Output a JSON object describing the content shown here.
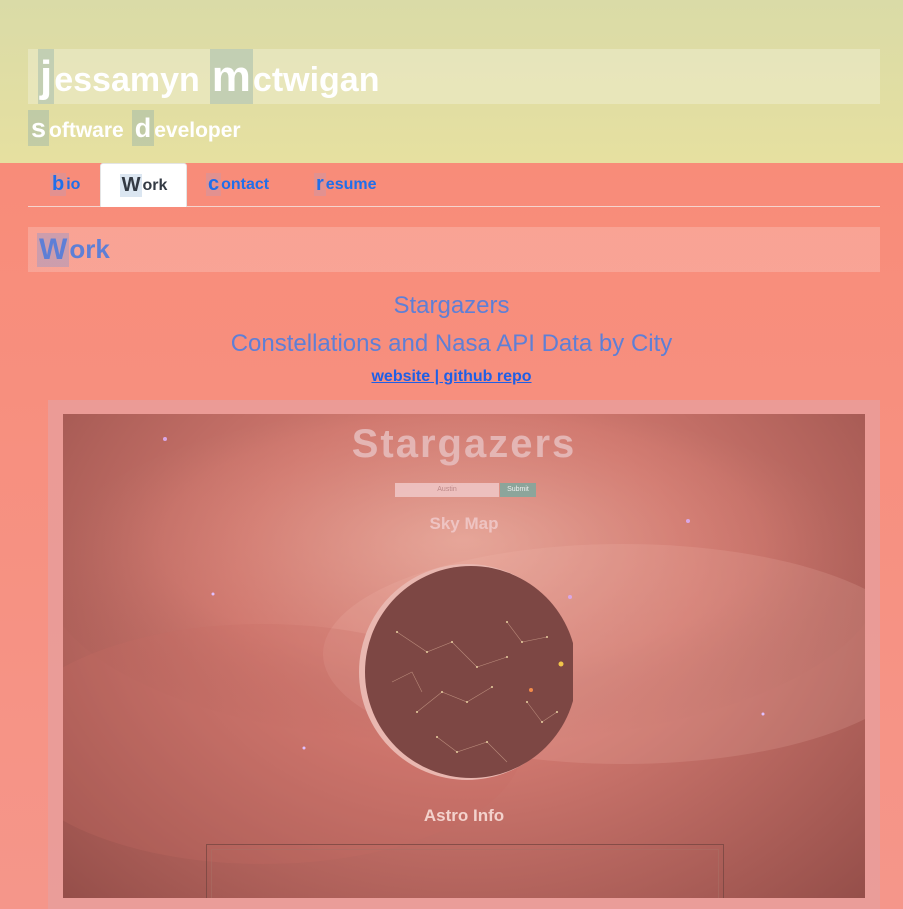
{
  "header": {
    "name": [
      {
        "cap": "j",
        "rest": "essamyn"
      },
      {
        "cap": "m",
        "rest": "ctwigan"
      }
    ],
    "subtitle": [
      {
        "cap": "s",
        "rest": "oftware"
      },
      {
        "cap": "d",
        "rest": "eveloper"
      }
    ]
  },
  "nav": {
    "tabs": [
      {
        "cap": "b",
        "rest": "io",
        "active": false
      },
      {
        "cap": "W",
        "rest": "ork",
        "active": true
      },
      {
        "cap": "c",
        "rest": "ontact",
        "active": false
      },
      {
        "cap": "r",
        "rest": "esume",
        "active": false
      }
    ]
  },
  "section": {
    "cap": "W",
    "rest": "ork"
  },
  "project": {
    "name": "Stargazers",
    "description": "Constellations and Nasa API Data by City",
    "links_text": "website | github repo",
    "screenshot": {
      "title": "Stargazers",
      "input_placeholder": "Austin",
      "submit_label": "Submit",
      "sky_map_heading": "Sky Map",
      "astro_heading": "Astro Info"
    }
  },
  "colors": {
    "header_bg": "#e0dca4",
    "main_bg": "#f6968a",
    "link": "#1f5fe6",
    "heading": "#5e7fd6"
  }
}
